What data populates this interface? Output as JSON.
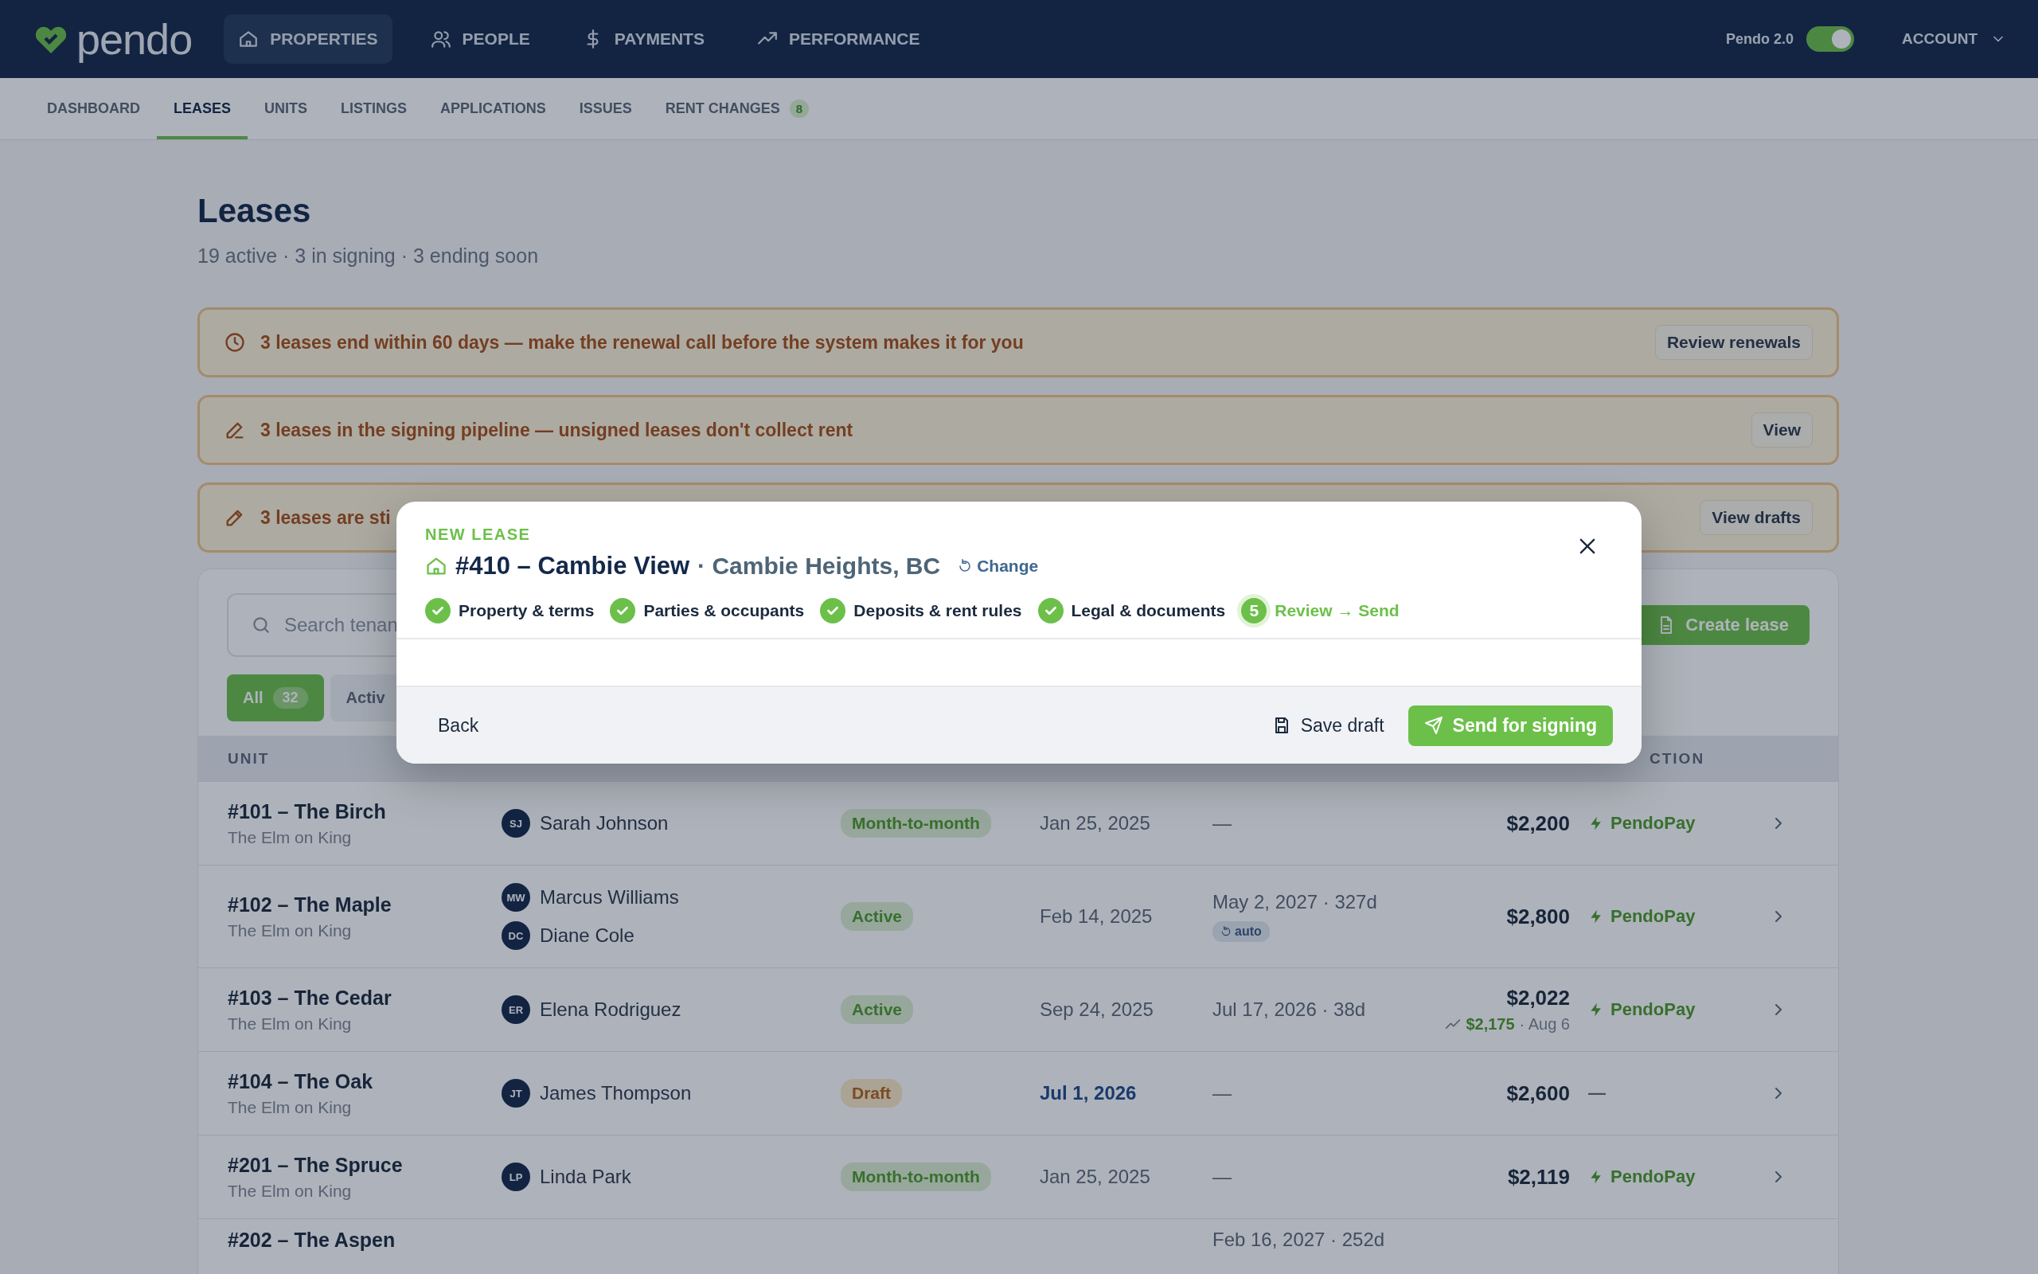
{
  "topnav": {
    "logo": "pendo",
    "items": [
      {
        "label": "PROPERTIES",
        "selected": true
      },
      {
        "label": "PEOPLE",
        "selected": false
      },
      {
        "label": "PAYMENTS",
        "selected": false
      },
      {
        "label": "PERFORMANCE",
        "selected": false
      }
    ],
    "toggle": {
      "label": "Pendo 2.0",
      "on": true
    },
    "account": "ACCOUNT"
  },
  "subnav": [
    {
      "label": "DASHBOARD",
      "selected": false
    },
    {
      "label": "LEASES",
      "selected": true
    },
    {
      "label": "UNITS",
      "selected": false
    },
    {
      "label": "LISTINGS",
      "selected": false
    },
    {
      "label": "APPLICATIONS",
      "selected": false
    },
    {
      "label": "ISSUES",
      "selected": false
    },
    {
      "label": "RENT CHANGES",
      "selected": false,
      "badge": "8"
    }
  ],
  "page": {
    "title": "Leases",
    "subtitle": "19 active · 3 in signing · 3 ending soon"
  },
  "banners": [
    {
      "text": "3 leases end within 60 days — make the renewal call before the system makes it for you",
      "action": "Review renewals"
    },
    {
      "text": "3 leases in the signing pipeline — unsigned leases don't collect rent",
      "action": "View"
    },
    {
      "text": "3 leases are sti",
      "action": "View drafts"
    }
  ],
  "toolbar": {
    "search_placeholder": "Search tenan",
    "create_button": "Create lease"
  },
  "filters": [
    {
      "label": "All",
      "count": "32",
      "selected": true
    },
    {
      "label": "Activ",
      "selected": false
    }
  ],
  "table": {
    "columns": [
      "UNIT",
      "CTION"
    ],
    "rows": [
      {
        "unit": "#101 – The Birch",
        "property": "The Elm on King",
        "tenants": [
          {
            "initials": "SJ",
            "name": "Sarah Johnson"
          }
        ],
        "status": {
          "label": "Month-to-month",
          "kind": "green"
        },
        "start": "Jan 25, 2025",
        "upcoming": false,
        "end": "—",
        "rent": "$2,200",
        "payment": "PendoPay",
        "autopay": true
      },
      {
        "unit": "#102 – The Maple",
        "property": "The Elm on King",
        "tenants": [
          {
            "initials": "MW",
            "name": "Marcus Williams"
          },
          {
            "initials": "DC",
            "name": "Diane Cole"
          }
        ],
        "status": {
          "label": "Active",
          "kind": "green"
        },
        "start": "Feb 14, 2025",
        "upcoming": false,
        "end": "May 2, 2027 · 327d",
        "end_badge": "auto",
        "rent": "$2,800",
        "payment": "PendoPay",
        "autopay": true
      },
      {
        "unit": "#103 – The Cedar",
        "property": "The Elm on King",
        "tenants": [
          {
            "initials": "ER",
            "name": "Elena Rodriguez"
          }
        ],
        "status": {
          "label": "Active",
          "kind": "green"
        },
        "start": "Sep 24, 2025",
        "upcoming": false,
        "end": "Jul 17, 2026 · 38d",
        "rent": "$2,022",
        "rent_change": {
          "amount": "$2,175",
          "date": "· Aug 6"
        },
        "payment": "PendoPay",
        "autopay": true
      },
      {
        "unit": "#104 – The Oak",
        "property": "The Elm on King",
        "tenants": [
          {
            "initials": "JT",
            "name": "James Thompson"
          }
        ],
        "status": {
          "label": "Draft",
          "kind": "amber"
        },
        "start": "Jul 1, 2026",
        "upcoming": true,
        "end": "—",
        "rent": "$2,600",
        "payment": "—",
        "autopay": false
      },
      {
        "unit": "#201 – The Spruce",
        "property": "The Elm on King",
        "tenants": [
          {
            "initials": "LP",
            "name": "Linda Park"
          }
        ],
        "status": {
          "label": "Month-to-month",
          "kind": "green"
        },
        "start": "Jan 25, 2025",
        "upcoming": false,
        "end": "—",
        "rent": "$2,119",
        "payment": "PendoPay",
        "autopay": true
      },
      {
        "unit": "#202 – The Aspen",
        "end": "Feb 16, 2027 · 252d"
      }
    ]
  },
  "modal": {
    "eyebrow": "NEW LEASE",
    "unit": "#410 – Cambie View",
    "location": "· Cambie Heights, BC",
    "change": "Change",
    "steps": [
      {
        "label": "Property & terms",
        "done": true,
        "selected": false
      },
      {
        "label": "Parties & occupants",
        "done": true,
        "selected": false
      },
      {
        "label": "Deposits & rent rules",
        "done": true,
        "selected": false
      },
      {
        "label": "Legal & documents",
        "done": true,
        "selected": false
      },
      {
        "number": "5",
        "label": "Review → Send",
        "done": false,
        "selected": true
      }
    ],
    "back": "Back",
    "save": "Save draft",
    "send": "Send for signing"
  }
}
